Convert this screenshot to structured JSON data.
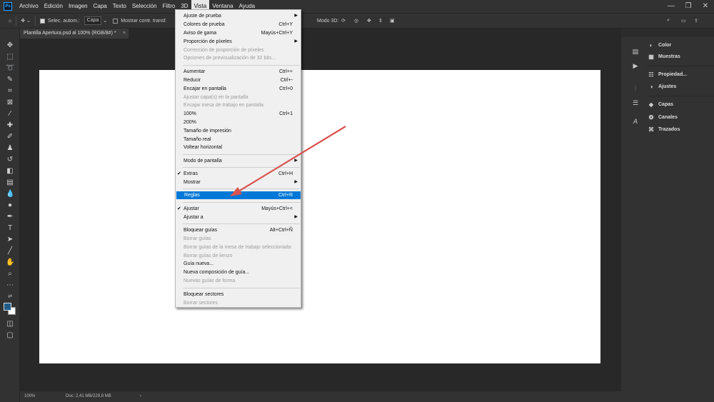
{
  "menubar": {
    "logo": "Ps",
    "items": [
      "Archivo",
      "Edición",
      "Imagen",
      "Capa",
      "Texto",
      "Selección",
      "Filtro",
      "3D",
      "Vista",
      "Ventana",
      "Ayuda"
    ],
    "active_item": "Vista",
    "window_controls": {
      "minimize": "—",
      "restore": "❐",
      "close": "✕"
    }
  },
  "options_bar": {
    "auto_select_label": "Selec. autom.:",
    "auto_select_value": "Capa",
    "show_transform_label": "Mostrar contr. transf.",
    "mode_3d_label": "Modo 3D:"
  },
  "document": {
    "tab_title": "Plantilla Apertura.psd al 100% (RGB/8#) *",
    "tab_close": "×"
  },
  "status_bar": {
    "zoom": "100%",
    "doc_info": "Doc: 2,41 MB/229,8 MB",
    "arrow": "›"
  },
  "right_panels": {
    "group1": [
      "Color",
      "Muestras"
    ],
    "group2": [
      "Propiedad...",
      "Ajustes"
    ],
    "group3": [
      "Capas",
      "Canales",
      "Trazados"
    ]
  },
  "vista_menu": {
    "items": [
      {
        "label": "Ajuste de prueba",
        "shortcut": "",
        "submenu": true,
        "disabled": false,
        "checked": false
      },
      {
        "label": "Colores de prueba",
        "shortcut": "Ctrl+Y",
        "submenu": false,
        "disabled": false,
        "checked": false
      },
      {
        "label": "Aviso de gama",
        "shortcut": "Mayús+Ctrl+Y",
        "submenu": false,
        "disabled": false,
        "checked": false
      },
      {
        "label": "Proporción de píxeles",
        "shortcut": "",
        "submenu": true,
        "disabled": false,
        "checked": false
      },
      {
        "label": "Corrección de proporción de píxeles",
        "shortcut": "",
        "submenu": false,
        "disabled": true,
        "checked": false
      },
      {
        "label": "Opciones de previsualización de 32 bits...",
        "shortcut": "",
        "submenu": false,
        "disabled": true,
        "checked": false
      },
      {
        "label": "Aumentar",
        "shortcut": "Ctrl++",
        "submenu": false,
        "disabled": false,
        "checked": false
      },
      {
        "label": "Reducir",
        "shortcut": "Ctrl+-",
        "submenu": false,
        "disabled": false,
        "checked": false
      },
      {
        "label": "Encajar en pantalla",
        "shortcut": "Ctrl+0",
        "submenu": false,
        "disabled": false,
        "checked": false
      },
      {
        "label": "Ajustar capa(s) en la pantalla",
        "shortcut": "",
        "submenu": false,
        "disabled": true,
        "checked": false
      },
      {
        "label": "Encajar mesa de trabajo en pantalla",
        "shortcut": "",
        "submenu": false,
        "disabled": true,
        "checked": false
      },
      {
        "label": "100%",
        "shortcut": "Ctrl+1",
        "submenu": false,
        "disabled": false,
        "checked": false
      },
      {
        "label": "200%",
        "shortcut": "",
        "submenu": false,
        "disabled": false,
        "checked": false
      },
      {
        "label": "Tamaño de impresión",
        "shortcut": "",
        "submenu": false,
        "disabled": false,
        "checked": false
      },
      {
        "label": "Tamaño real",
        "shortcut": "",
        "submenu": false,
        "disabled": false,
        "checked": false
      },
      {
        "label": "Voltear horizontal",
        "shortcut": "",
        "submenu": false,
        "disabled": false,
        "checked": false
      },
      {
        "label": "Modo de pantalla",
        "shortcut": "",
        "submenu": true,
        "disabled": false,
        "checked": false
      },
      {
        "label": "Extras",
        "shortcut": "Ctrl+H",
        "submenu": false,
        "disabled": false,
        "checked": true
      },
      {
        "label": "Mostrar",
        "shortcut": "",
        "submenu": true,
        "disabled": false,
        "checked": false
      },
      {
        "label": "Reglas",
        "shortcut": "Ctrl+R",
        "submenu": false,
        "disabled": false,
        "checked": false,
        "highlighted": true
      },
      {
        "label": "Ajustar",
        "shortcut": "Mayús+Ctrl+<",
        "submenu": false,
        "disabled": false,
        "checked": true
      },
      {
        "label": "Ajustar a",
        "shortcut": "",
        "submenu": true,
        "disabled": false,
        "checked": false
      },
      {
        "label": "Bloquear guías",
        "shortcut": "Alt+Ctrl+Ñ",
        "submenu": false,
        "disabled": false,
        "checked": false
      },
      {
        "label": "Borrar guías",
        "shortcut": "",
        "submenu": false,
        "disabled": true,
        "checked": false
      },
      {
        "label": "Borrar guías de la mesa de trabajo seleccionada",
        "shortcut": "",
        "submenu": false,
        "disabled": true,
        "checked": false
      },
      {
        "label": "Borrar guías de lienzo",
        "shortcut": "",
        "submenu": false,
        "disabled": true,
        "checked": false
      },
      {
        "label": "Guía nueva...",
        "shortcut": "",
        "submenu": false,
        "disabled": false,
        "checked": false
      },
      {
        "label": "Nueva composición de guía...",
        "shortcut": "",
        "submenu": false,
        "disabled": false,
        "checked": false
      },
      {
        "label": "Nuevas guías de forma",
        "shortcut": "",
        "submenu": false,
        "disabled": true,
        "checked": false
      },
      {
        "label": "Bloquear sectores",
        "shortcut": "",
        "submenu": false,
        "disabled": false,
        "checked": false
      },
      {
        "label": "Borrar sectores",
        "shortcut": "",
        "submenu": false,
        "disabled": true,
        "checked": false
      }
    ]
  },
  "colors": {
    "highlight": "#0078d7",
    "annotation_arrow": "#d9534f",
    "foreground_color": "#1f5c8a"
  }
}
